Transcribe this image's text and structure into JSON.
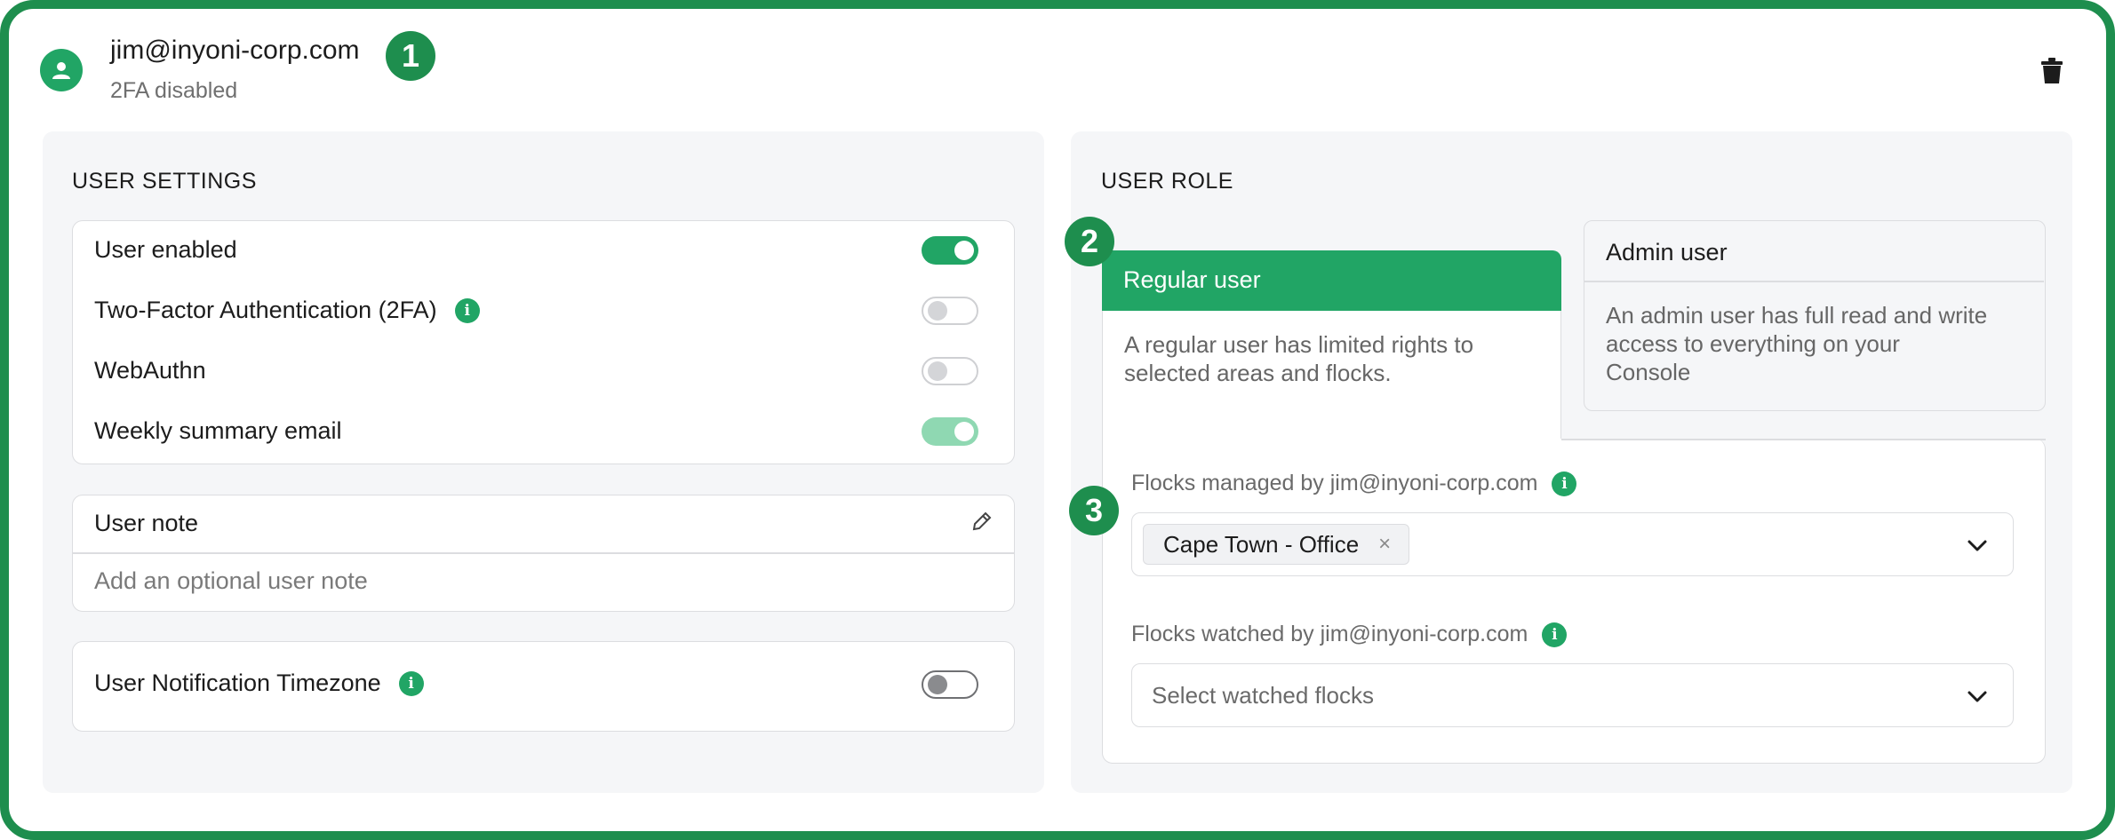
{
  "header": {
    "email": "jim@inyoni-corp.com",
    "twofa_status": "2FA disabled"
  },
  "badges": [
    "1",
    "2",
    "3"
  ],
  "user_settings": {
    "title": "USER SETTINGS",
    "toggles": [
      {
        "label": "User enabled",
        "state": "on"
      },
      {
        "label": "Two-Factor Authentication (2FA)",
        "state": "off",
        "info": true
      },
      {
        "label": "WebAuthn",
        "state": "off"
      },
      {
        "label": "Weekly summary email",
        "state": "on-disabled"
      }
    ],
    "note": {
      "title": "User note",
      "placeholder": "Add an optional user note"
    },
    "timezone": {
      "label": "User Notification Timezone",
      "state": "off",
      "info": true
    }
  },
  "user_role": {
    "title": "USER ROLE",
    "regular": {
      "title": "Regular user",
      "description_line1": "A regular user has limited rights to",
      "description_line2": "selected areas and flocks.",
      "selected": true
    },
    "admin": {
      "title": "Admin user",
      "description_line1": "An admin user has full read and write",
      "description_line2": "access to everything on your",
      "description_line3": "Console",
      "selected": false
    },
    "managed_label": "Flocks managed by jim@inyoni-corp.com",
    "managed_chip": "Cape Town - Office",
    "watched_label": "Flocks watched by jim@inyoni-corp.com",
    "watched_placeholder": "Select watched flocks"
  },
  "icons": {
    "info": "i",
    "chip_remove": "×"
  },
  "colors": {
    "accent": "#21a565",
    "frame": "#1e8e4e"
  }
}
